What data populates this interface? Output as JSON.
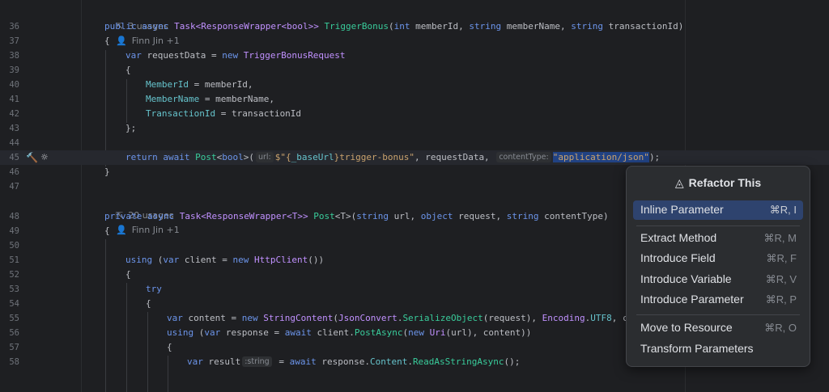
{
  "editor": {
    "lens1": {
      "usages": "3 usages",
      "author": "Finn Jin +1"
    },
    "lens2": {
      "usages": "20 usages",
      "author": "Finn Jin +1"
    },
    "line_numbers": [
      "36",
      "37",
      "38",
      "39",
      "40",
      "41",
      "42",
      "43",
      "44",
      "45",
      "46",
      "47",
      "48",
      "49",
      "50",
      "51",
      "52",
      "53",
      "54",
      "55",
      "56",
      "57",
      "58"
    ],
    "code": {
      "l36": {
        "kw": "public async",
        "type": "Task<ResponseWrapper<bool>>",
        "fn": "TriggerBonus",
        "params_a": "(",
        "p1t": "int",
        "p1": " memberId, ",
        "p2t": "string",
        "p2": " memberName, ",
        "p3t": "string",
        "p3": " transactionId)"
      },
      "l37": "{",
      "l38": {
        "kw": "var",
        "mid": " requestData = ",
        "kw2": "new",
        "type": "TriggerBonusRequest"
      },
      "l39": "{",
      "l40": {
        "field": "MemberId",
        "rest": " = memberId,"
      },
      "l41": {
        "field": "MemberName",
        "rest": " = memberName,"
      },
      "l42": {
        "field": "TransactionId",
        "rest": " = transactionId"
      },
      "l43": "};",
      "l45": {
        "kw": "return await",
        "fn": "Post",
        "gen_a": "<",
        "gen": "bool",
        "gen_b": ">(",
        "hint_url": "url:",
        "str_a": "$\"{",
        "interp": "_baseUrl",
        "str_b": "}trigger-bonus\"",
        "mid": ", requestData, ",
        "hint_ct": "contentType:",
        "str_c": "\"application/json\"",
        "end": ");"
      },
      "l46": "}",
      "l48": {
        "kw": "private async",
        "type": "Task<ResponseWrapper<T>>",
        "fn": "Post",
        "gen": "<T>",
        "p_a": "(",
        "p1t": "string",
        "p1": " url, ",
        "p2t": "object",
        "p2": " request, ",
        "p3t": "string",
        "p3": " contentType)"
      },
      "l49": "{",
      "l51": {
        "kw": "using",
        "a": " (",
        "kw2": "var",
        "b": " client = ",
        "kw3": "new",
        "type": "HttpClient",
        "end": "())"
      },
      "l52": "{",
      "l53": "try",
      "l54": "{",
      "l55": {
        "kw": "var",
        "a": " content = ",
        "kw2": "new",
        "type": "StringContent",
        "b": "(",
        "type2": "JsonConvert",
        "c": ".",
        "fn": "SerializeObject",
        "d": "(request), ",
        "type3": "Encoding",
        "e": ".",
        "field": "UTF8",
        "f": ", cont"
      },
      "l56": {
        "kw": "using",
        "a": " (",
        "kw2": "var",
        "b": " response = ",
        "kw3": "await",
        "c": " client.",
        "fn": "PostAsync",
        "d": "(",
        "kw4": "new",
        "e": " ",
        "type": "Uri",
        "f": "(url), content))"
      },
      "l57": "{",
      "l58": {
        "kw": "var",
        "a": " result",
        "hint": ":string",
        "b": " = ",
        "kw2": "await",
        "c": " response.",
        "fld": "Content",
        "d": ".",
        "fn": "ReadAsStringAsync",
        "end": "();"
      }
    }
  },
  "popup": {
    "title": "Refactor This",
    "items": [
      {
        "label": "Inline Parameter",
        "shortcut": "⌘R, I",
        "selected": true
      },
      {
        "label": "Extract Method",
        "shortcut": "⌘R, M"
      },
      {
        "label": "Introduce Field",
        "shortcut": "⌘R, F"
      },
      {
        "label": "Introduce Variable",
        "shortcut": "⌘R, V"
      },
      {
        "label": "Introduce Parameter",
        "shortcut": "⌘R, P"
      },
      {
        "label": "Move to Resource",
        "shortcut": "⌘R, O"
      },
      {
        "label": "Transform Parameters",
        "shortcut": ""
      }
    ]
  }
}
